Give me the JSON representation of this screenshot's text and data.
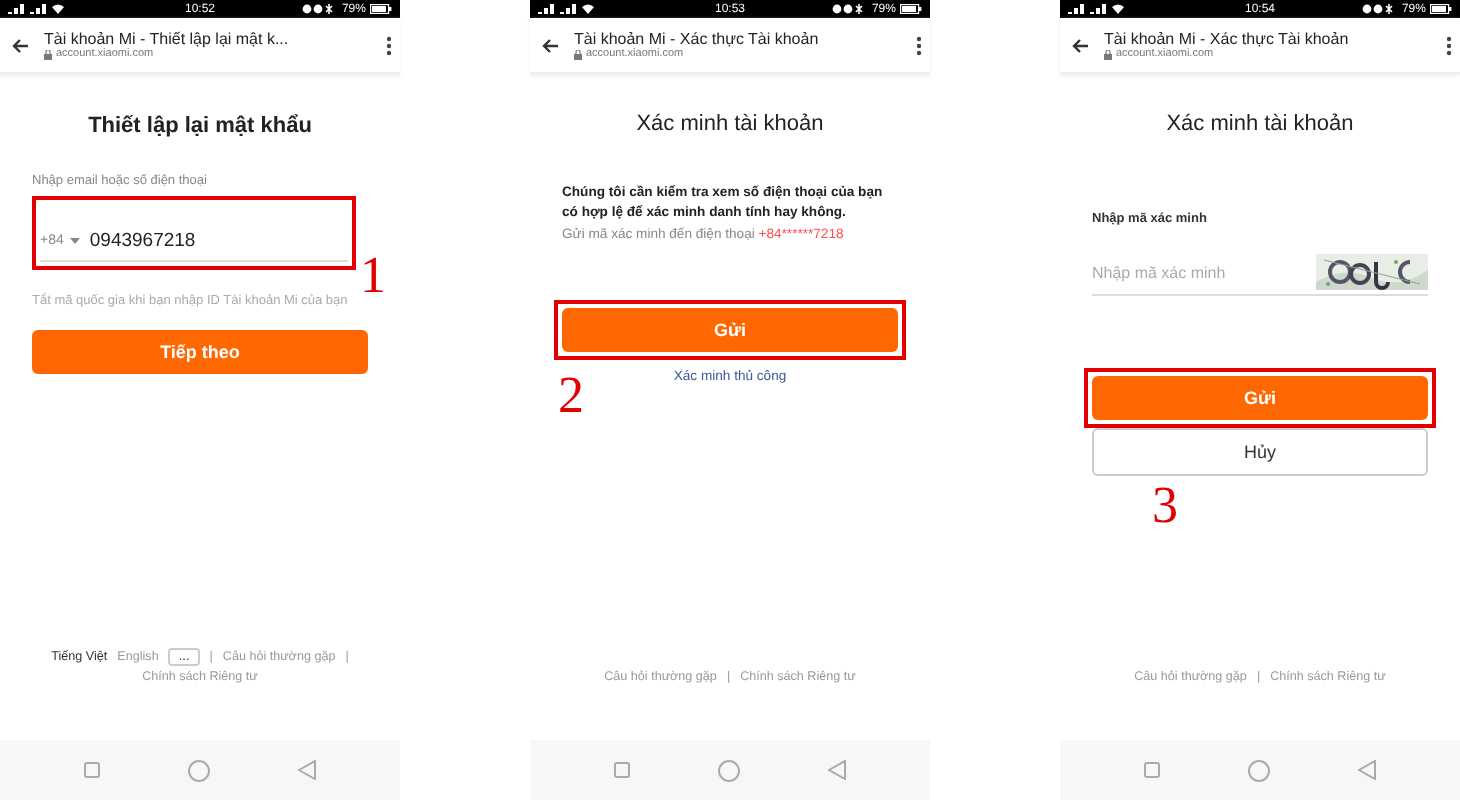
{
  "screens": [
    {
      "status_bar": {
        "time": "10:52",
        "battery": "79%"
      },
      "browser": {
        "title": "Tài khoản Mi - Thiết lập lại mật k...",
        "url": "account.xiaomi.com"
      },
      "heading": "Thiết lập lại mật khẩu",
      "kind": "phone_entry",
      "field_label": "Nhập email hoặc số điện thoại",
      "country_code": "+84",
      "phone": "0943967218",
      "field_highlight": true,
      "hint": "Tắt mã quốc gia khi bạn nhập ID Tài khoản Mi của bạn",
      "buttons": [
        {
          "label": "Tiếp theo",
          "kind": "primary"
        }
      ],
      "callout": "1",
      "footer": [
        {
          "text": "Tiếng Việt",
          "kind": "lang",
          "selected": true
        },
        {
          "text": "English",
          "kind": "lang",
          "selected": false
        },
        {
          "text": "...",
          "kind": "more"
        },
        {
          "text": "|",
          "kind": "sep"
        },
        {
          "text": "Câu hỏi thường gặp",
          "kind": "link"
        },
        {
          "text": "|",
          "kind": "sep"
        },
        {
          "text": "Chính sách Riêng tư",
          "kind": "link"
        }
      ]
    },
    {
      "status_bar": {
        "time": "10:53",
        "battery": "79%"
      },
      "browser": {
        "title": "Tài khoản Mi - Xác thực Tài khoản",
        "url": "account.xiaomi.com"
      },
      "heading": "Xác minh tài khoản",
      "kind": "send_code",
      "message": "Chúng tôi cần kiểm tra xem số điện thoại của bạn có hợp lệ để xác minh danh tính hay không.",
      "send_text": "Gửi mã xác minh đến điện thoại",
      "masked_phone": "+84******7218",
      "buttons": [
        {
          "label": "Gửi",
          "kind": "primary",
          "highlight": true
        }
      ],
      "link": "Xác minh thủ công",
      "callout": "2",
      "footer": [
        {
          "text": "Câu hỏi thường gặp",
          "kind": "link"
        },
        {
          "text": "|",
          "kind": "sep"
        },
        {
          "text": "Chính sách Riêng tư",
          "kind": "link"
        }
      ]
    },
    {
      "status_bar": {
        "time": "10:54",
        "battery": "79%"
      },
      "browser": {
        "title": "Tài khoản Mi - Xác thực Tài khoản",
        "url": "account.xiaomi.com"
      },
      "heading": "Xác minh tài khoản",
      "kind": "enter_code",
      "field_label": "Nhập mã xác minh",
      "placeholder": "Nhập mã xác minh",
      "buttons": [
        {
          "label": "Gửi",
          "kind": "primary",
          "highlight": true
        },
        {
          "label": "Hủy",
          "kind": "secondary"
        }
      ],
      "callout": "3",
      "footer": [
        {
          "text": "Câu hỏi thường gặp",
          "kind": "link"
        },
        {
          "text": "|",
          "kind": "sep"
        },
        {
          "text": "Chính sách Riêng tư",
          "kind": "link"
        }
      ]
    }
  ]
}
